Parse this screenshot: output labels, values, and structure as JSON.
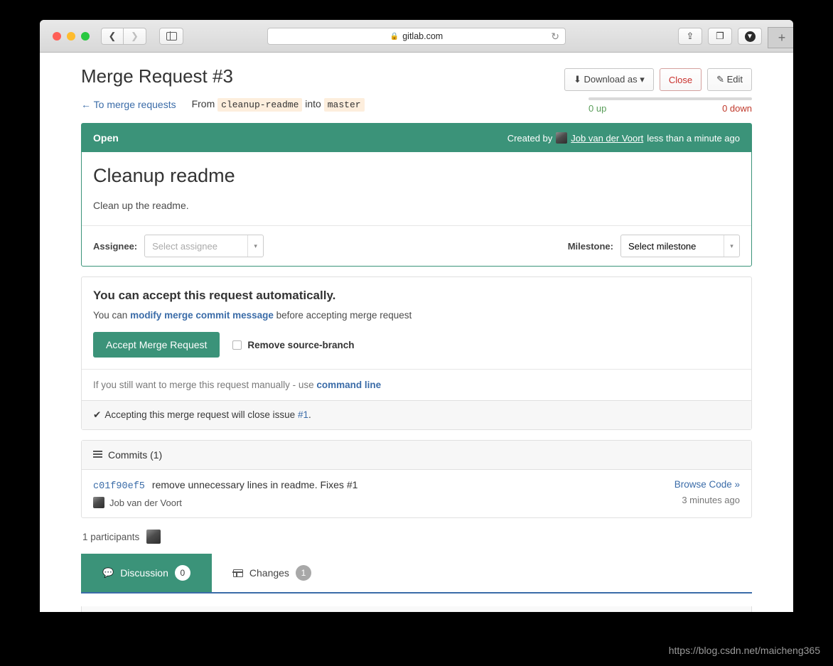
{
  "browser": {
    "url": "gitlab.com",
    "lock_icon": "lock-icon",
    "back_icon": "chevron-left-icon",
    "forward_icon": "chevron-right-icon",
    "sidebar_icon": "sidebar-toggle-icon",
    "reload_icon": "reload-icon",
    "share_icon": "share-icon",
    "tabs_icon": "tab-overview-icon",
    "downloads_icon": "downloads-icon",
    "new_tab_label": "+"
  },
  "header": {
    "title": "Merge Request #3",
    "download_label": "Download as",
    "download_icon": "download-icon",
    "download_caret": "▾",
    "close_label": "Close",
    "edit_label": "Edit",
    "edit_icon": "edit-icon",
    "votes_up": "0 up",
    "votes_down": "0 down"
  },
  "breadcrumb": {
    "back_label": "← To merge requests",
    "from_label": "From",
    "source_branch": "cleanup-readme",
    "into_label": "into",
    "target_branch": "master"
  },
  "merge_request": {
    "state": "Open",
    "created_by_label": "Created by",
    "author": "Job van der Voort",
    "created_at": "less than a minute ago",
    "title": "Cleanup readme",
    "description": "Clean up the readme.",
    "assignee_label": "Assignee:",
    "assignee_value": "Select assignee",
    "milestone_label": "Milestone:",
    "milestone_value": "Select milestone",
    "caret": "▾"
  },
  "accept_card": {
    "heading": "You can accept this request automatically.",
    "sub_prefix": "You can ",
    "sub_link": "modify merge commit message",
    "sub_suffix": " before accepting merge request",
    "accept_button": "Accept Merge Request",
    "remove_branch_label": "Remove source-branch",
    "manual_prefix": "If you still want to merge this request manually - use ",
    "manual_link": "command line",
    "close_issue_tick": "✔",
    "close_issue_prefix": "Accepting this merge request will close issue ",
    "close_issue_link": "#1",
    "close_issue_suffix": "."
  },
  "commits": {
    "header_label": "Commits (1)",
    "header_icon": "list-icon",
    "rows": [
      {
        "sha": "c01f90ef5",
        "message": "remove unnecessary lines in readme. Fixes #1",
        "author": "Job van der Voort",
        "browse_label": "Browse Code »",
        "time": "3 minutes ago"
      }
    ]
  },
  "participants": {
    "label": "1 participants"
  },
  "tabs": [
    {
      "label": "Discussion",
      "count": "0",
      "icon": "comment-icon",
      "active": true
    },
    {
      "label": "Changes",
      "count": "1",
      "icon": "diff-icon",
      "active": false
    }
  ],
  "watermark": "https://blog.csdn.net/maicheng365",
  "colors": {
    "green": "#3b9379",
    "link_blue": "#3b6ca8",
    "danger_red": "#c9302c",
    "branch_bg": "#fdeedd"
  }
}
